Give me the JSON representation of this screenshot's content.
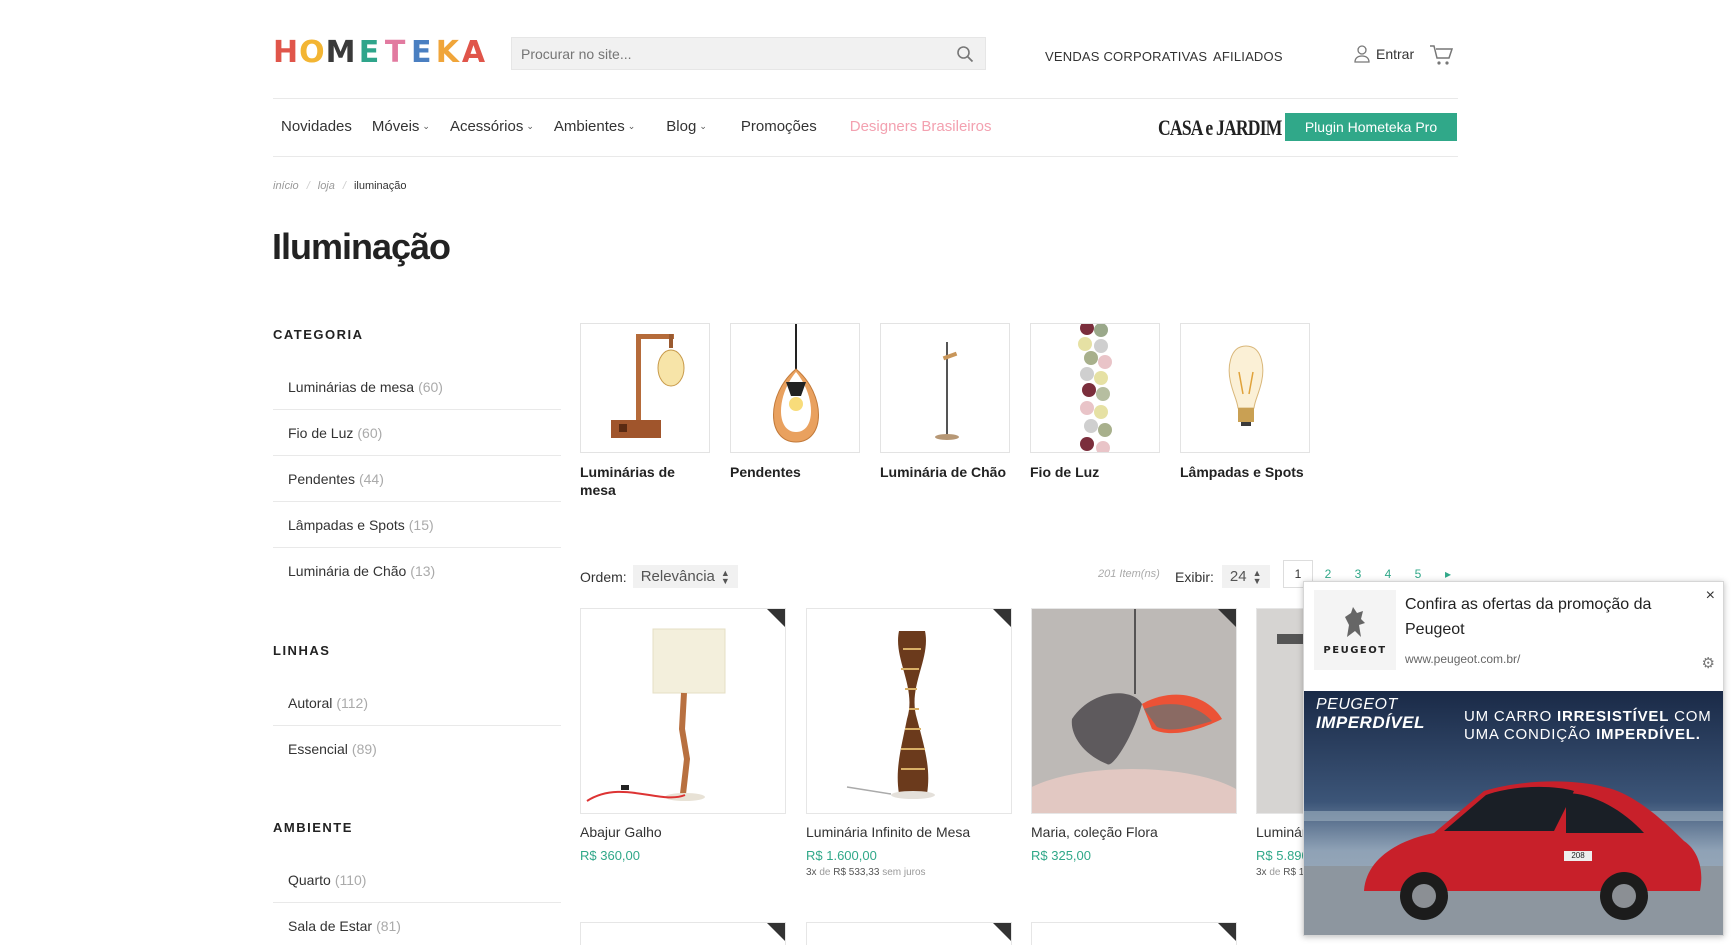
{
  "brand": {
    "logo_text": [
      "H",
      "O",
      "M",
      "E",
      "T",
      "E",
      "K",
      "A"
    ],
    "logo_colors": [
      "#e0554a",
      "#f3b533",
      "#3a3a3a",
      "#2fa58b",
      "#e27aa0",
      "#4a7fc1",
      "#f0a53a",
      "#e0554a"
    ]
  },
  "header": {
    "search_placeholder": "Procurar no site...",
    "vendas": "VENDAS CORPORATIVAS",
    "afiliados": "AFILIADOS",
    "entrar": "Entrar"
  },
  "nav": {
    "items": [
      {
        "label": "Novidades",
        "dropdown": false
      },
      {
        "label": "Móveis",
        "dropdown": true
      },
      {
        "label": "Acessórios",
        "dropdown": true
      },
      {
        "label": "Ambientes",
        "dropdown": true
      },
      {
        "label": "Blog",
        "dropdown": true
      },
      {
        "label": "Promoções",
        "dropdown": false
      }
    ],
    "designers": "Designers Brasileiros",
    "casa": "CASA e JARDIM",
    "plugin": "Plugin Hometeka Pro"
  },
  "breadcrumb": {
    "inicio": "início",
    "sep": "/",
    "loja": "loja",
    "current": "iluminação"
  },
  "page_title": "Iluminação",
  "sidebar": {
    "categoria_title": "CATEGORIA",
    "categoria": [
      {
        "label": "Luminárias de mesa",
        "count": "(60)"
      },
      {
        "label": "Fio de Luz",
        "count": "(60)"
      },
      {
        "label": "Pendentes",
        "count": "(44)"
      },
      {
        "label": "Lâmpadas e Spots",
        "count": "(15)"
      },
      {
        "label": "Luminária de Chão",
        "count": "(13)"
      }
    ],
    "linhas_title": "LINHAS",
    "linhas": [
      {
        "label": "Autoral",
        "count": "(112)"
      },
      {
        "label": "Essencial",
        "count": "(89)"
      }
    ],
    "ambiente_title": "AMBIENTE",
    "ambiente": [
      {
        "label": "Quarto",
        "count": "(110)"
      },
      {
        "label": "Sala de Estar",
        "count": "(81)"
      }
    ]
  },
  "categories": [
    {
      "label": "Luminárias de mesa"
    },
    {
      "label": "Pendentes"
    },
    {
      "label": "Luminária de Chão"
    },
    {
      "label": "Fio de Luz"
    },
    {
      "label": "Lâmpadas e Spots"
    }
  ],
  "toolbar": {
    "ordem_label": "Ordem:",
    "ordem_value": "Relevância",
    "items_count": "201 Item(ns)",
    "exibir_label": "Exibir:",
    "exibir_value": "24",
    "pages": [
      "1",
      "2",
      "3",
      "4",
      "5"
    ],
    "next": "▸"
  },
  "products": [
    {
      "name": "Abajur Galho",
      "price": "R$ 360,00",
      "inst_x": "",
      "inst_de": "",
      "inst_val": "",
      "inst_juros": ""
    },
    {
      "name": "Luminária Infinito de Mesa",
      "price": "R$ 1.600,00",
      "inst_x": "3x",
      "inst_de": "de",
      "inst_val": "R$ 533,33",
      "inst_juros": "sem juros"
    },
    {
      "name": "Maria, coleção Flora",
      "price": "R$ 325,00",
      "inst_x": "",
      "inst_de": "",
      "inst_val": "",
      "inst_juros": ""
    },
    {
      "name": "Luminár",
      "price": "R$ 5.890",
      "inst_x": "3x",
      "inst_de": "de",
      "inst_val": "R$ 1",
      "inst_juros": ""
    }
  ],
  "popup": {
    "brand": "PEUGEOT",
    "title": "Confira as ofertas da promoção da Peugeot",
    "url": "www.peugeot.com.br/",
    "close": "×",
    "gear": "⚙",
    "banner_left_1": "PEUGEOT",
    "banner_left_2": "IMPERDÍVEL",
    "banner_right_1a": "UM CARRO ",
    "banner_right_1b": "IRRESISTÍVEL",
    "banner_right_1c": " COM",
    "banner_right_2a": "UMA CONDIÇÃO ",
    "banner_right_2b": "IMPERDÍVEL.",
    "plate": "208"
  },
  "colors": {
    "accent": "#30a889",
    "pink": "#f3a1b0",
    "car": "#c8202a"
  }
}
